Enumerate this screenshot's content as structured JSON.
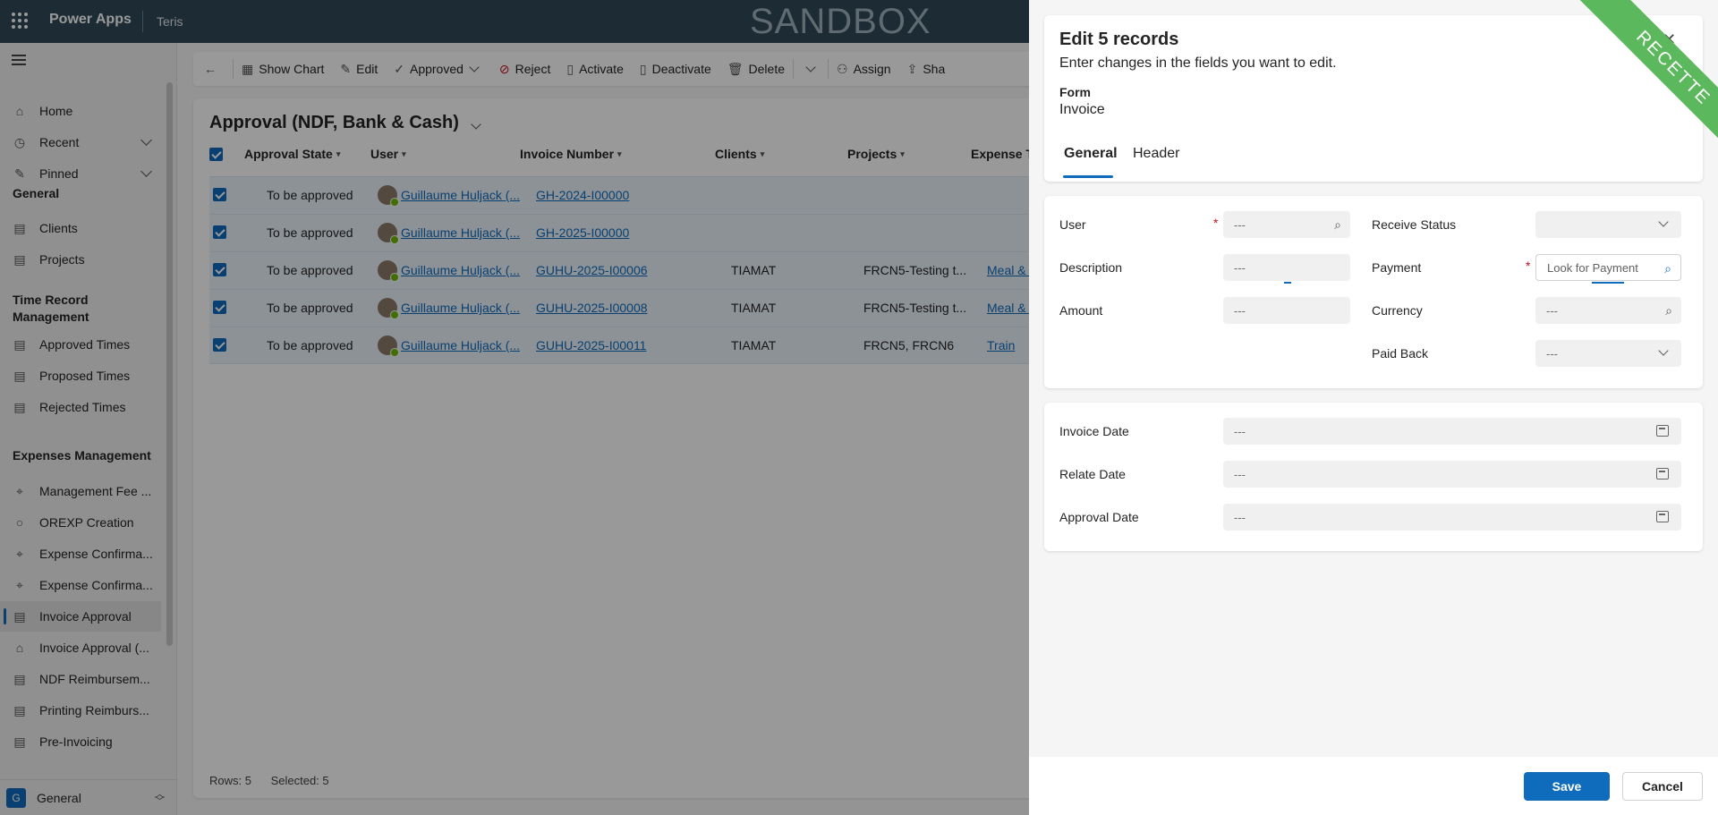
{
  "topbar": {
    "app_name": "Power Apps",
    "env_name": "Teris",
    "sandbox_label": "SANDBOX"
  },
  "sidebar": {
    "items_top": [
      {
        "label": "Home",
        "icon": "home-icon"
      },
      {
        "label": "Recent",
        "icon": "clock-icon"
      },
      {
        "label": "Pinned",
        "icon": "pin-icon"
      }
    ],
    "group_general": "General",
    "general_items": [
      {
        "label": "Clients",
        "icon": "document-icon"
      },
      {
        "label": "Projects",
        "icon": "document-icon"
      }
    ],
    "group_time": "Time Record Management",
    "time_items": [
      {
        "label": "Approved Times",
        "icon": "document-icon"
      },
      {
        "label": "Proposed Times",
        "icon": "document-icon"
      },
      {
        "label": "Rejected Times",
        "icon": "document-icon"
      }
    ],
    "group_expenses": "Expenses Management",
    "expense_items": [
      {
        "label": "Management Fee ...",
        "icon": "tag-icon"
      },
      {
        "label": "OREXP Creation",
        "icon": "circle-icon"
      },
      {
        "label": "Expense Confirma...",
        "icon": "tag-icon"
      },
      {
        "label": "Expense Confirma...",
        "icon": "tag-icon"
      },
      {
        "label": "Invoice Approval",
        "icon": "document-icon"
      },
      {
        "label": "Invoice Approval (...",
        "icon": "bank-icon"
      },
      {
        "label": "NDF Reimbursem...",
        "icon": "document-icon"
      },
      {
        "label": "Printing Reimburs...",
        "icon": "document-icon"
      },
      {
        "label": "Pre-Invoicing",
        "icon": "document-icon"
      }
    ],
    "area": {
      "letter": "G",
      "label": "General"
    }
  },
  "commandbar": {
    "show_chart": "Show Chart",
    "edit": "Edit",
    "approved": "Approved",
    "reject": "Reject",
    "activate": "Activate",
    "deactivate": "Deactivate",
    "delete": "Delete",
    "assign": "Assign",
    "share": "Sha"
  },
  "view": {
    "title": "Approval (NDF, Bank & Cash)",
    "columns": [
      "Approval State",
      "User",
      "Invoice Number",
      "Clients",
      "Projects",
      "Expense Ty"
    ],
    "rows": [
      {
        "state": "To be approved",
        "user": "Guillaume Huljack (...",
        "invoice": "GH-2024-I00000",
        "client": "",
        "project": "",
        "expense": ""
      },
      {
        "state": "To be approved",
        "user": "Guillaume Huljack (...",
        "invoice": "GH-2025-I00000",
        "client": "",
        "project": "",
        "expense": ""
      },
      {
        "state": "To be approved",
        "user": "Guillaume Huljack (...",
        "invoice": "GUHU-2025-I00006",
        "client": "TIAMAT",
        "project": "FRCN5-Testing t...",
        "expense": "Meal & Su"
      },
      {
        "state": "To be approved",
        "user": "Guillaume Huljack (...",
        "invoice": "GUHU-2025-I00008",
        "client": "TIAMAT",
        "project": "FRCN5-Testing t...",
        "expense": "Meal & Su"
      },
      {
        "state": "To be approved",
        "user": "Guillaume Huljack (...",
        "invoice": "GUHU-2025-I00011",
        "client": "TIAMAT",
        "project": "FRCN5,  FRCN6",
        "expense": "Train"
      }
    ],
    "rows_label": "Rows: 5",
    "selected_label": "Selected: 5"
  },
  "panel": {
    "title": "Edit 5 records",
    "subtitle": "Enter changes in the fields you want to edit.",
    "form_label": "Form",
    "form_value": "Invoice",
    "tabs": [
      "General",
      "Header"
    ],
    "ribbon": "RECETTE",
    "fields": {
      "user": {
        "label": "User",
        "value": "---"
      },
      "description": {
        "label": "Description",
        "value": "---"
      },
      "amount": {
        "label": "Amount",
        "value": "---"
      },
      "receive_status": {
        "label": "Receive Status",
        "value": ""
      },
      "payment": {
        "label": "Payment",
        "placeholder": "Look for Payment"
      },
      "currency": {
        "label": "Currency",
        "value": "---"
      },
      "paid_back": {
        "label": "Paid Back",
        "value": "---"
      },
      "invoice_date": {
        "label": "Invoice Date",
        "value": "---"
      },
      "relate_date": {
        "label": "Relate Date",
        "value": "---"
      },
      "approval_date": {
        "label": "Approval Date",
        "value": "---"
      }
    },
    "save": "Save",
    "cancel": "Cancel"
  },
  "colors": {
    "accent": "#0f6cbd",
    "topbar": "#2f4858",
    "ribbon": "#5cb85c"
  }
}
